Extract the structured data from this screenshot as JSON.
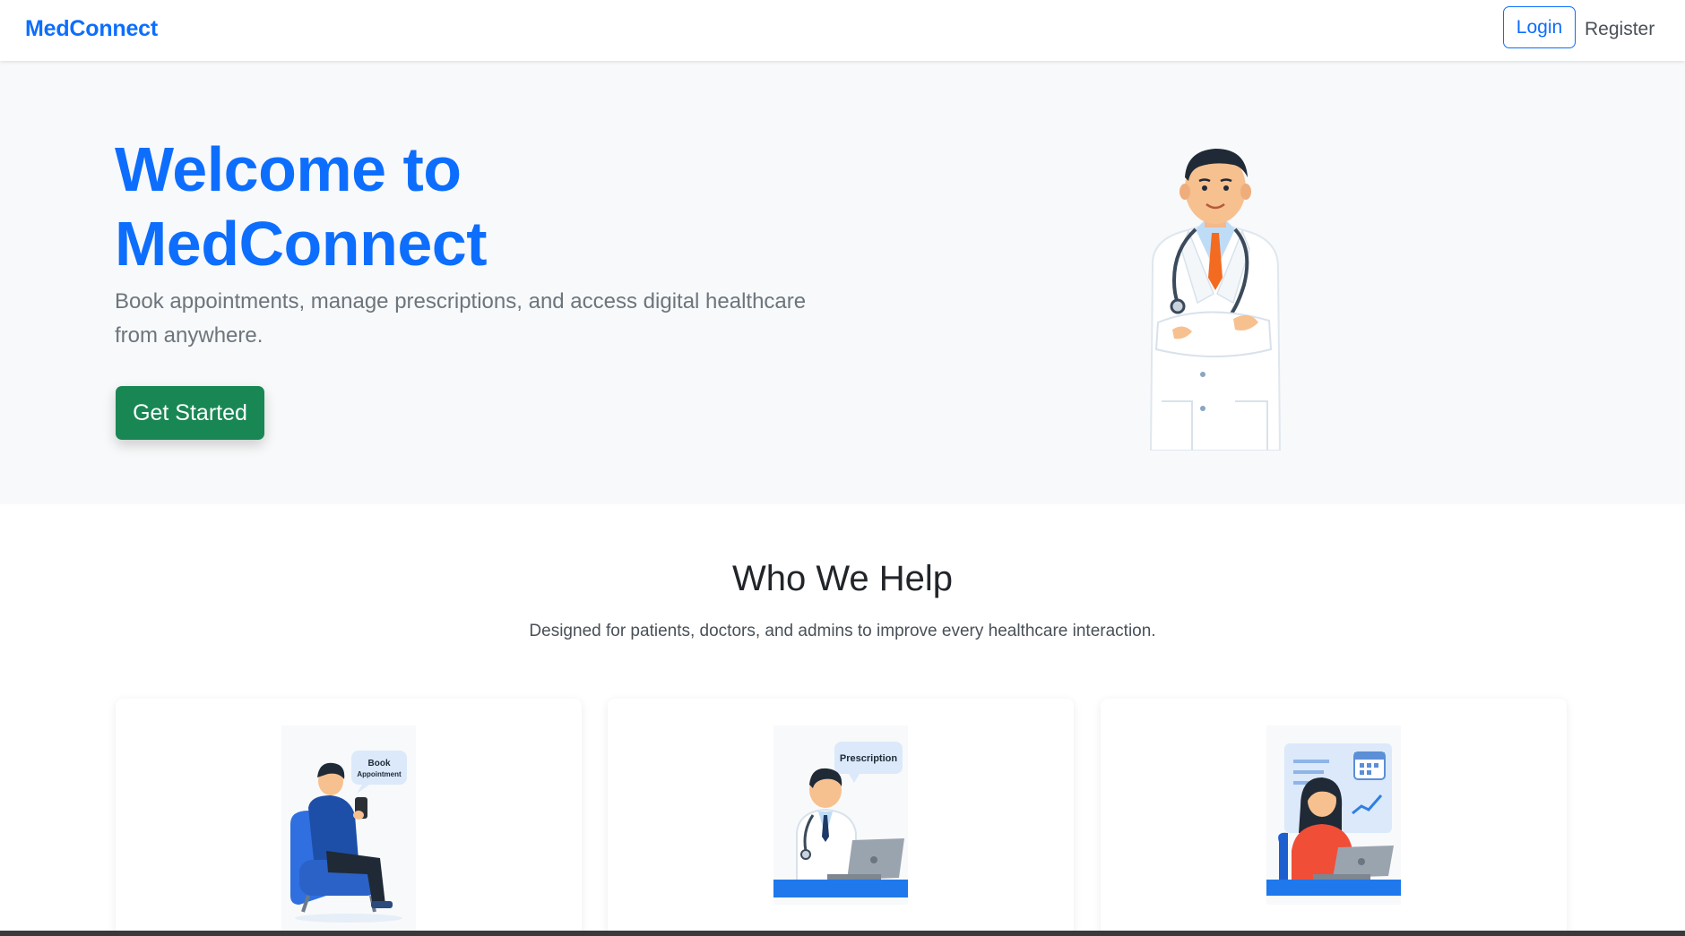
{
  "navbar": {
    "brand": "MedConnect",
    "login_label": "Login",
    "register_label": "Register"
  },
  "hero": {
    "title": "Welcome to MedConnect",
    "subtitle": "Book appointments, manage prescriptions, and access digital healthcare from anywhere.",
    "cta_label": "Get Started"
  },
  "who_we_help": {
    "title": "Who We Help",
    "subtitle": "Designed for patients, doctors, and admins to improve every healthcare interaction.",
    "cards": [
      {
        "illustration": "patient-booking-illustration",
        "bubble": "Book Appointment"
      },
      {
        "illustration": "doctor-prescription-illustration",
        "bubble": "Prescription"
      },
      {
        "illustration": "admin-dashboard-illustration"
      }
    ]
  },
  "colors": {
    "primary": "#0d6efd",
    "success": "#198754",
    "hero_bg": "#f8f9fa"
  }
}
